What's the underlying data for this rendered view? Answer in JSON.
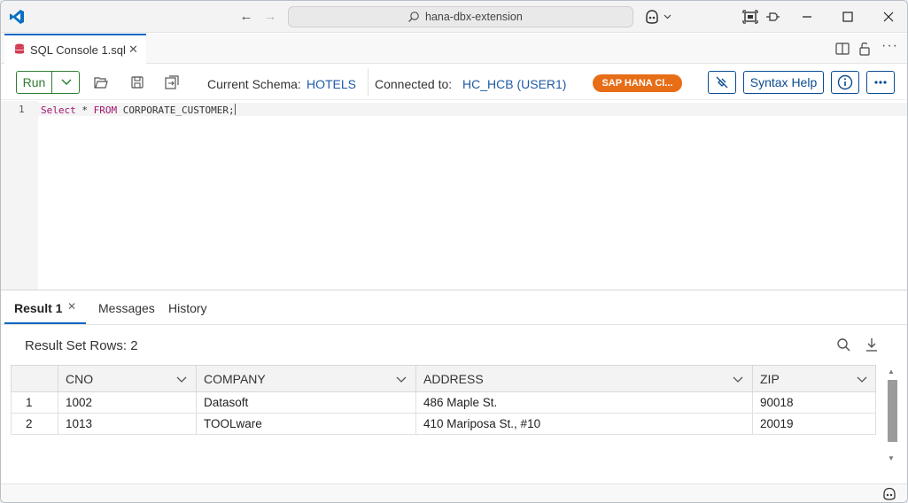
{
  "window": {
    "command_center": "hana-dbx-extension"
  },
  "editor_tab": {
    "label": "SQL Console 1.sql",
    "close": "✕"
  },
  "toolbar": {
    "run_label": "Run",
    "schema_label": "Current Schema:",
    "schema_value": "HOTELS",
    "connected_label": "Connected to:",
    "connected_value": "HC_HCB (USER1)",
    "database_badge": "SAP HANA Cl...",
    "syntax_help_label": "Syntax Help",
    "accent_color": "#2e7d32",
    "badge_color": "#e76d16"
  },
  "editor": {
    "line_number": "1",
    "code": {
      "kw1": "Select",
      "rest1": " * ",
      "kw2": "FROM",
      "rest2": " CORPORATE_CUSTOMER;"
    }
  },
  "results": {
    "tabs": {
      "result": "Result 1",
      "result_close": "✕",
      "messages": "Messages",
      "history": "History"
    },
    "row_count_label": "Result Set Rows: 2",
    "columns": [
      "CNO",
      "COMPANY",
      "ADDRESS",
      "ZIP"
    ],
    "rows": [
      {
        "index": "1",
        "CNO": "1002",
        "COMPANY": "Datasoft",
        "ADDRESS": "486 Maple St.",
        "ZIP": "90018"
      },
      {
        "index": "2",
        "CNO": "1013",
        "COMPANY": "TOOLware",
        "ADDRESS": "410 Mariposa St., #10",
        "ZIP": "20019"
      }
    ]
  }
}
